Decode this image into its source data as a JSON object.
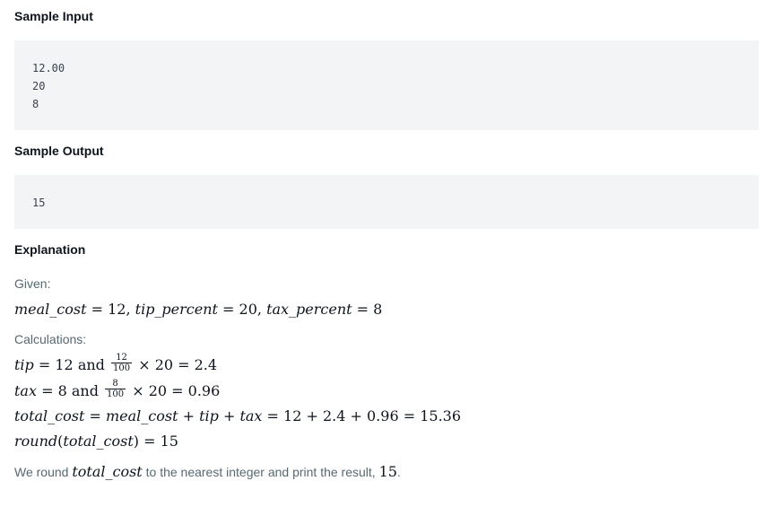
{
  "sample_input": {
    "heading": "Sample Input",
    "lines": [
      "12.00",
      "20",
      "8"
    ]
  },
  "sample_output": {
    "heading": "Sample Output",
    "lines": [
      "15"
    ]
  },
  "explanation": {
    "heading": "Explanation",
    "given_label": "Given:",
    "given": {
      "meal_var": "meal_cost",
      "meal_val": "12",
      "tip_var": "tip_percent",
      "tip_val": "20",
      "tax_var": "tax_percent",
      "tax_val": "8"
    },
    "calc_label": "Calculations:",
    "tip_line": {
      "var": "tip",
      "base": "12",
      "and_word": "and",
      "num": "12",
      "den": "100",
      "pct": "20",
      "result": "2.4"
    },
    "tax_line": {
      "var": "tax",
      "base": "8",
      "and_word": "and",
      "num": "8",
      "den": "100",
      "pct": "20",
      "result": "0.96"
    },
    "total_line": {
      "var": "total_cost",
      "meal": "meal_cost",
      "tip": "tip",
      "tax": "tax",
      "a": "12",
      "b": "2.4",
      "c": "0.96",
      "result": "15.36"
    },
    "round_line": {
      "fn": "round",
      "arg": "total_cost",
      "result": "15"
    },
    "conclusion": {
      "prefix": "We round ",
      "var": "total_cost",
      "middle": " to the nearest integer and print the result, ",
      "value": "15",
      "suffix": "."
    }
  }
}
